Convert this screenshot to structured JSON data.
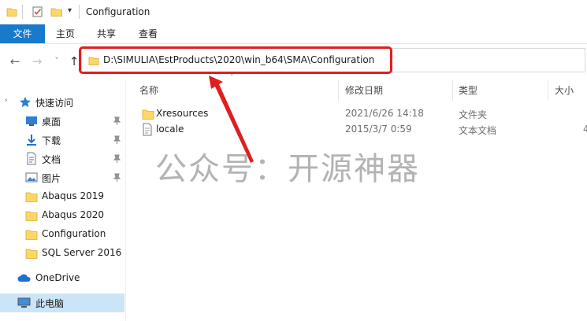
{
  "window": {
    "title": "Configuration",
    "qat_dropdown": "▾"
  },
  "ribbon": {
    "tabs": [
      "文件",
      "主页",
      "共享",
      "查看"
    ]
  },
  "nav": {
    "back": "←",
    "forward": "→",
    "recent": "˅",
    "up": "↑"
  },
  "address": {
    "path": "D:\\SIMULIA\\EstProducts\\2020\\win_b64\\SMA\\Configuration"
  },
  "sidebar": {
    "items": [
      {
        "label": "快速访问",
        "icon": "star-icon",
        "pinned": false
      },
      {
        "label": "桌面",
        "icon": "desktop-icon",
        "pinned": true
      },
      {
        "label": "下载",
        "icon": "download-icon",
        "pinned": true
      },
      {
        "label": "文档",
        "icon": "document-icon",
        "pinned": true
      },
      {
        "label": "图片",
        "icon": "picture-icon",
        "pinned": true
      },
      {
        "label": "Abaqus 2019",
        "icon": "folder-icon",
        "pinned": false
      },
      {
        "label": "Abaqus 2020",
        "icon": "folder-icon",
        "pinned": false
      },
      {
        "label": "Configuration",
        "icon": "folder-icon",
        "pinned": false
      },
      {
        "label": "SQL Server 2016",
        "icon": "folder-icon",
        "pinned": false
      },
      {
        "label": "OneDrive",
        "icon": "cloud-icon",
        "pinned": false
      },
      {
        "label": "此电脑",
        "icon": "computer-icon",
        "pinned": false
      }
    ]
  },
  "columns": {
    "name": "名称",
    "modified": "修改日期",
    "type": "类型",
    "size": "大小"
  },
  "files": [
    {
      "name": "Xresources",
      "modified": "2021/6/26 14:18",
      "type": "文件夹",
      "size": "",
      "icon": "folder-icon"
    },
    {
      "name": "locale",
      "modified": "2015/3/7 0:59",
      "type": "文本文档",
      "size": "4",
      "icon": "text-file-icon"
    }
  ],
  "watermark": "公众号：开源神器",
  "colors": {
    "accent": "#1979ca",
    "highlight": "#e01e1e",
    "selection": "#cce4f7",
    "folder": "#ffd766"
  }
}
